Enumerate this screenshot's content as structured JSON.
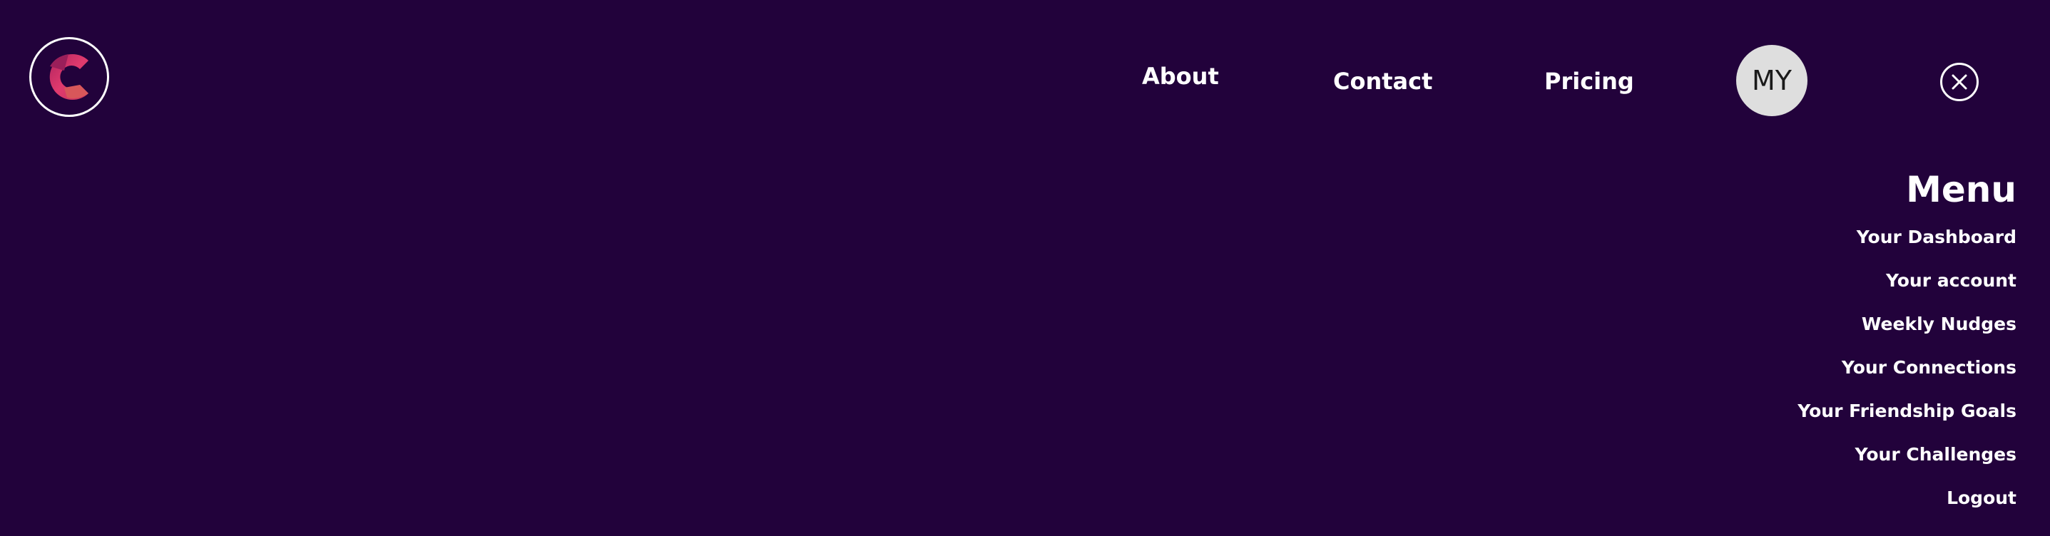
{
  "colors": {
    "background": "#22023b",
    "text": "#ffffff",
    "avatar_bg": "#dedede",
    "logo_accent": "#e03a6e"
  },
  "logo": {
    "icon": "c-logo-icon"
  },
  "nav": {
    "about": "About",
    "contact": "Contact",
    "pricing": "Pricing"
  },
  "avatar": {
    "initials": "MY"
  },
  "close": {
    "icon": "close-icon"
  },
  "menu": {
    "title": "Menu",
    "items": [
      {
        "label": "Your Dashboard"
      },
      {
        "label": "Your account"
      },
      {
        "label": "Weekly Nudges"
      },
      {
        "label": "Your Connections"
      },
      {
        "label": "Your Friendship Goals"
      },
      {
        "label": "Your Challenges"
      },
      {
        "label": "Logout"
      }
    ]
  }
}
